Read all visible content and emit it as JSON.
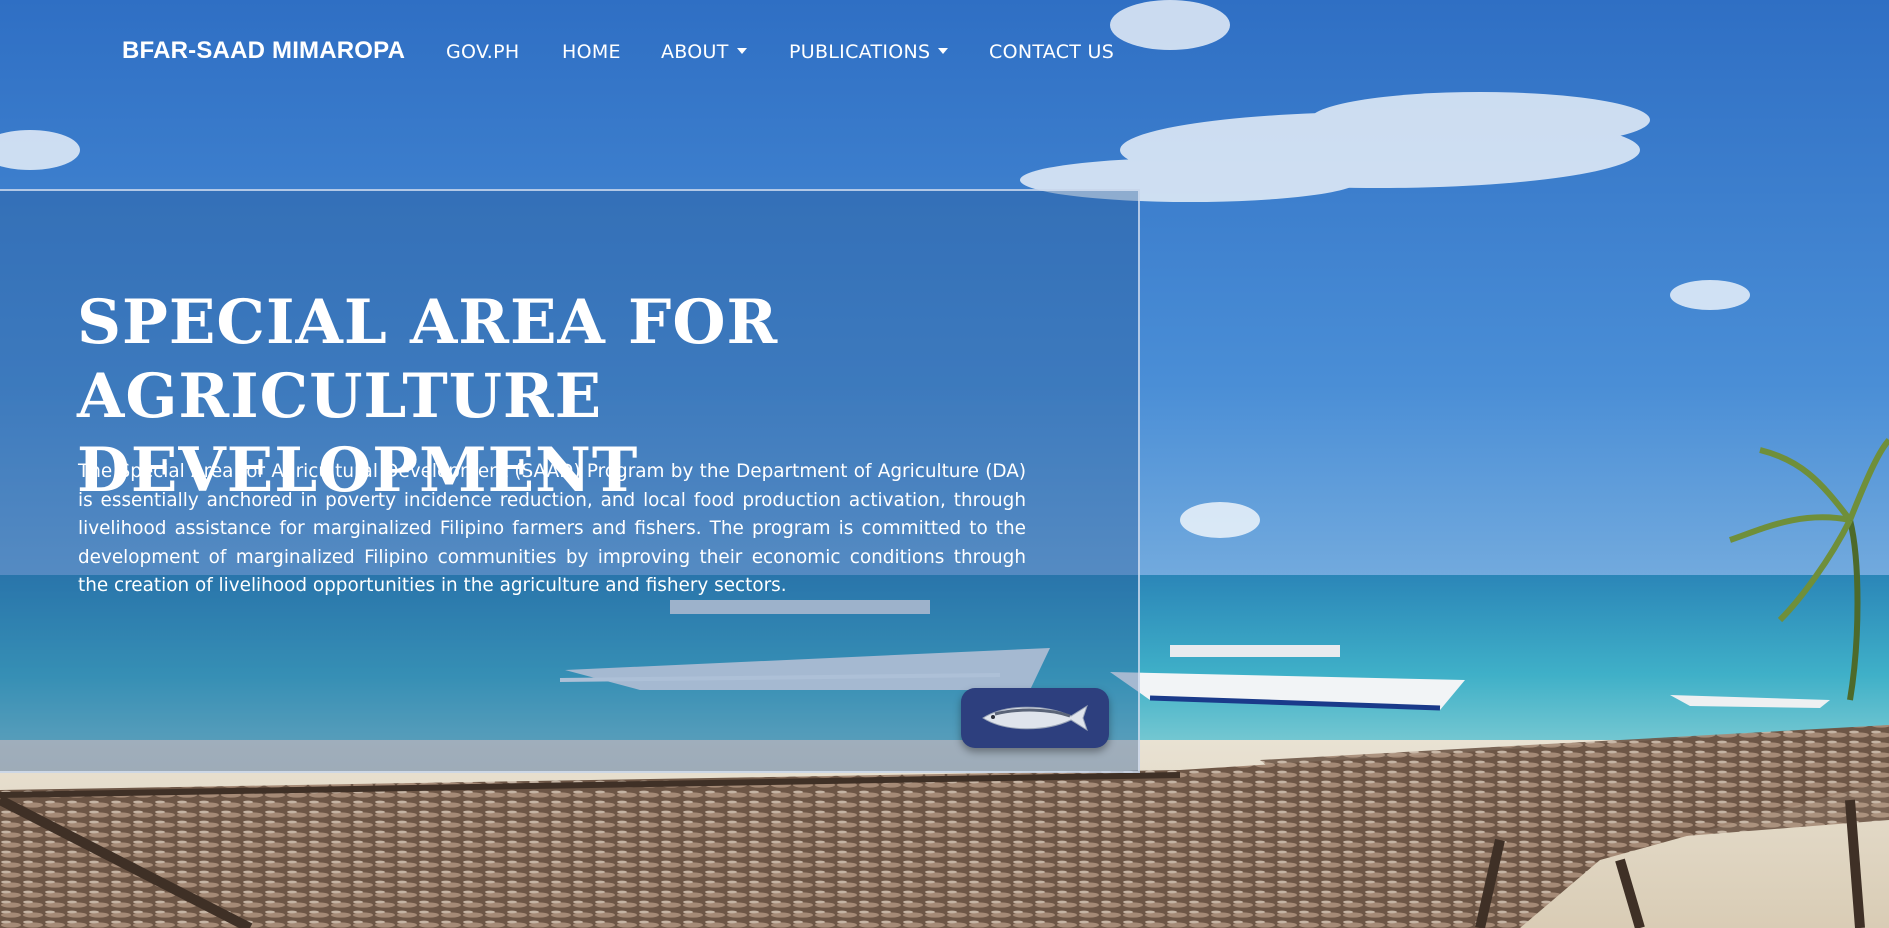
{
  "navbar": {
    "brand": "BFAR-SAAD MIMAROPA",
    "items": [
      {
        "label": "GOV.PH",
        "dropdown": false
      },
      {
        "label": "HOME",
        "dropdown": false
      },
      {
        "label": "ABOUT",
        "dropdown": true
      },
      {
        "label": "PUBLICATIONS",
        "dropdown": true
      },
      {
        "label": "CONTACT US",
        "dropdown": false
      }
    ]
  },
  "hero": {
    "title": "SPECIAL AREA FOR\nAGRICULTURE DEVELOPMENT",
    "description": "The Special Area for Agricultural Development (SAAD) Program by the Department of Agriculture (DA) is essentially anchored in poverty incidence reduction, and local food production activation, through livelihood assistance for marginalized Filipino farmers and fishers. The program is committed to the development of marginalized Filipino communities by improving their economic conditions through the creation of livelihood opportunities in the agriculture and fishery sectors.",
    "fish_button_icon": "fish-icon"
  },
  "background": {
    "icon": "beach-boats-fish-drying-photo",
    "sky_color": "#3b7fd0",
    "sea_color": "#3fa9c8",
    "sand_color": "#e8dcc8"
  }
}
